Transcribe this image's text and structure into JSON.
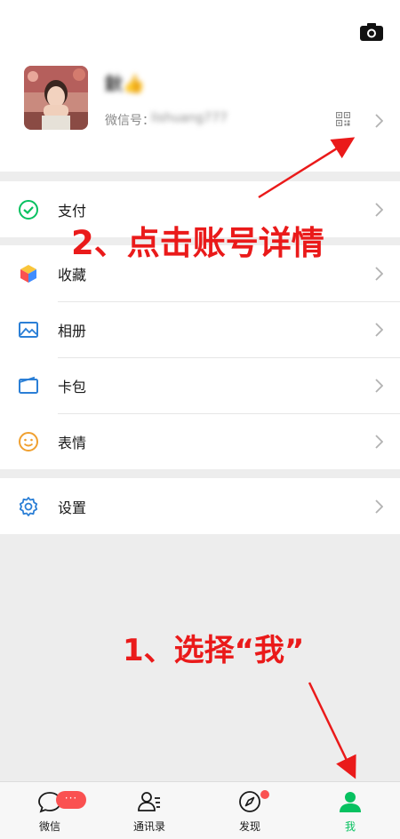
{
  "profile": {
    "nickname": "鈥👍",
    "wechat_id_label": "微信号：",
    "wechat_id_value": "lishuang777"
  },
  "menu": {
    "pay": "支付",
    "favorites": "收藏",
    "album": "相册",
    "cards": "卡包",
    "stickers": "表情",
    "settings": "设置"
  },
  "annotations": {
    "step2": "2、点击账号详情",
    "step1": "1、选择“我”"
  },
  "tabbar": {
    "chats": "微信",
    "contacts": "通讯录",
    "discover": "发现",
    "me": "我",
    "chats_badge": "···"
  },
  "colors": {
    "accent": "#07c160",
    "annotation": "#ea1a1a",
    "badge": "#fa5151"
  },
  "icons": {
    "camera": "camera-icon",
    "qr": "qr-code-icon",
    "pay": "pay-icon",
    "favorites": "cube-icon",
    "album": "picture-icon",
    "cards": "wallet-icon",
    "stickers": "smiley-icon",
    "settings": "gear-icon"
  }
}
